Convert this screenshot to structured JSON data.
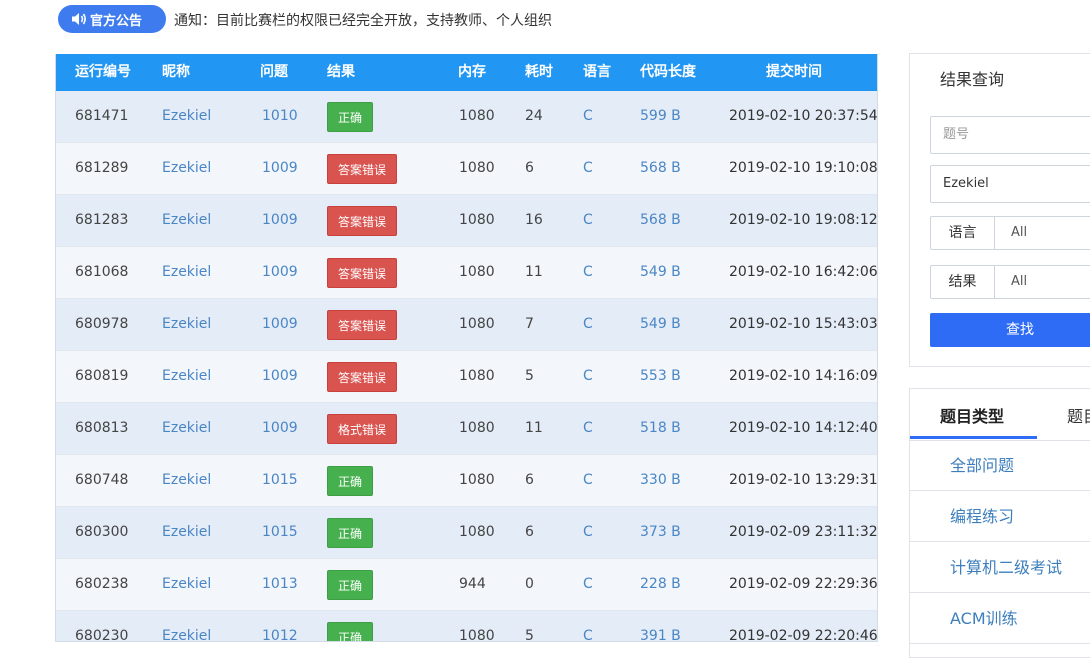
{
  "notice": {
    "badge_label": "官方公告",
    "text": "通知：目前比赛栏的权限已经完全开放，支持教师、个人组织"
  },
  "table": {
    "headers": {
      "run_id": "运行编号",
      "nickname": "昵称",
      "problem": "问题",
      "result": "结果",
      "memory": "内存",
      "time": "耗时",
      "language": "语言",
      "code_length": "代码长度",
      "submit_time": "提交时间"
    },
    "rows": [
      {
        "run_id": "681471",
        "nickname": "Ezekiel",
        "problem": "1010",
        "result": "正确",
        "result_type": "ok",
        "memory": "1080",
        "time": "24",
        "language": "C",
        "code_length": "599 B",
        "submit_time": "2019-02-10 20:37:54"
      },
      {
        "run_id": "681289",
        "nickname": "Ezekiel",
        "problem": "1009",
        "result": "答案错误",
        "result_type": "wa",
        "memory": "1080",
        "time": "6",
        "language": "C",
        "code_length": "568 B",
        "submit_time": "2019-02-10 19:10:08"
      },
      {
        "run_id": "681283",
        "nickname": "Ezekiel",
        "problem": "1009",
        "result": "答案错误",
        "result_type": "wa",
        "memory": "1080",
        "time": "16",
        "language": "C",
        "code_length": "568 B",
        "submit_time": "2019-02-10 19:08:12"
      },
      {
        "run_id": "681068",
        "nickname": "Ezekiel",
        "problem": "1009",
        "result": "答案错误",
        "result_type": "wa",
        "memory": "1080",
        "time": "11",
        "language": "C",
        "code_length": "549 B",
        "submit_time": "2019-02-10 16:42:06"
      },
      {
        "run_id": "680978",
        "nickname": "Ezekiel",
        "problem": "1009",
        "result": "答案错误",
        "result_type": "wa",
        "memory": "1080",
        "time": "7",
        "language": "C",
        "code_length": "549 B",
        "submit_time": "2019-02-10 15:43:03"
      },
      {
        "run_id": "680819",
        "nickname": "Ezekiel",
        "problem": "1009",
        "result": "答案错误",
        "result_type": "wa",
        "memory": "1080",
        "time": "5",
        "language": "C",
        "code_length": "553 B",
        "submit_time": "2019-02-10 14:16:09"
      },
      {
        "run_id": "680813",
        "nickname": "Ezekiel",
        "problem": "1009",
        "result": "格式错误",
        "result_type": "pe",
        "memory": "1080",
        "time": "11",
        "language": "C",
        "code_length": "518 B",
        "submit_time": "2019-02-10 14:12:40"
      },
      {
        "run_id": "680748",
        "nickname": "Ezekiel",
        "problem": "1015",
        "result": "正确",
        "result_type": "ok",
        "memory": "1080",
        "time": "6",
        "language": "C",
        "code_length": "330 B",
        "submit_time": "2019-02-10 13:29:31"
      },
      {
        "run_id": "680300",
        "nickname": "Ezekiel",
        "problem": "1015",
        "result": "正确",
        "result_type": "ok",
        "memory": "1080",
        "time": "6",
        "language": "C",
        "code_length": "373 B",
        "submit_time": "2019-02-09 23:11:32"
      },
      {
        "run_id": "680238",
        "nickname": "Ezekiel",
        "problem": "1013",
        "result": "正确",
        "result_type": "ok",
        "memory": "944",
        "time": "0",
        "language": "C",
        "code_length": "228 B",
        "submit_time": "2019-02-09 22:29:36"
      },
      {
        "run_id": "680230",
        "nickname": "Ezekiel",
        "problem": "1012",
        "result": "正确",
        "result_type": "ok",
        "memory": "1080",
        "time": "5",
        "language": "C",
        "code_length": "391 B",
        "submit_time": "2019-02-09 22:20:46"
      }
    ]
  },
  "query": {
    "title": "结果查询",
    "problem_placeholder": "题号",
    "nickname_value": "Ezekiel",
    "language_label": "语言",
    "language_value": "All",
    "result_label": "结果",
    "result_value": "All",
    "search_button": "查找"
  },
  "categories": {
    "tab_active": "题目类型",
    "tab_other": "题目",
    "items": [
      "全部问题",
      "编程练习",
      "计算机二级考试",
      "ACM训练"
    ]
  },
  "colors": {
    "header_blue": "#2196f3",
    "accent_blue": "#2f6cf5",
    "badge_ok": "#46b04e",
    "badge_error": "#d9534f",
    "link": "#4a86c5"
  }
}
